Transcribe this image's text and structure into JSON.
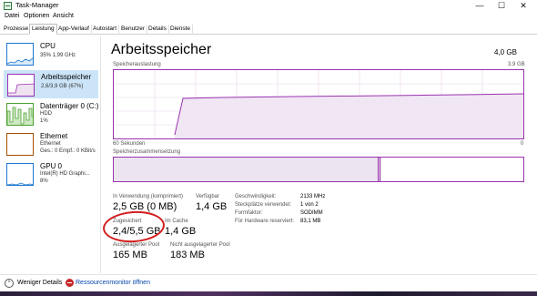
{
  "window": {
    "title": "Task-Manager",
    "minimize_glyph": "—",
    "maximize_glyph": "☐",
    "close_glyph": "✕"
  },
  "menu": [
    "Datei",
    "Optionen",
    "Ansicht"
  ],
  "tabs": [
    "Prozesse",
    "Leistung",
    "App-Verlauf",
    "Autostart",
    "Benutzer",
    "Details",
    "Dienste"
  ],
  "active_tab": "Leistung",
  "sidebar": [
    {
      "name": "CPU",
      "lines": [
        "35% 1,99 GHz"
      ],
      "color": "#1e77d0"
    },
    {
      "name": "Arbeitsspeicher",
      "lines": [
        "2,6/3,9 GB (67%)"
      ],
      "color": "#9a33b0",
      "selected": true
    },
    {
      "name": "Datenträger 0 (C:)",
      "lines": [
        "HDD",
        "1%"
      ],
      "color": "#4aa02c"
    },
    {
      "name": "Ethernet",
      "lines": [
        "Ethernet",
        "Ges.: 0 Empf.: 0 KBit/s"
      ],
      "color": "#a74f01"
    },
    {
      "name": "GPU 0",
      "lines": [
        "Intel(R) HD Graphi...",
        "8%"
      ],
      "color": "#1e77d0"
    }
  ],
  "main": {
    "title": "Arbeitsspeicher",
    "total": "4,0 GB",
    "graph_label": "Speicherauslastung",
    "graph_max": "3,9 GB",
    "graph_time": "60 Sekunden",
    "graph_min": "0",
    "composition_label": "Speicherzusammensetzung",
    "accent_color": "#9a33b0"
  },
  "stats": {
    "in_use_label": "In Verwendung (komprimiert)",
    "in_use_value": "2,5 GB (0 MB)",
    "available_label": "Verfügbar",
    "available_value": "1,4 GB",
    "committed_label": "Zugesichert",
    "committed_value": "2,4/5,5 GB",
    "cached_label": "Im Cache",
    "cached_value": "1,4 GB",
    "paged_label": "Ausgelagerter Pool",
    "paged_value": "165 MB",
    "nonpaged_label": "Nicht ausgelagerter Pool",
    "nonpaged_value": "183 MB"
  },
  "details": [
    {
      "label": "Geschwindigkeit:",
      "value": "2133 MHz"
    },
    {
      "label": "Steckplätze verwendet:",
      "value": "1 von 2"
    },
    {
      "label": "Formfaktor:",
      "value": "SODIMM"
    },
    {
      "label": "Für Hardware reserviert:",
      "value": "83,1 MB"
    }
  ],
  "footer": {
    "fewer_details": "Weniger Details",
    "resource_monitor": "Ressourcenmonitor öffnen",
    "chevron_glyph": "^"
  }
}
